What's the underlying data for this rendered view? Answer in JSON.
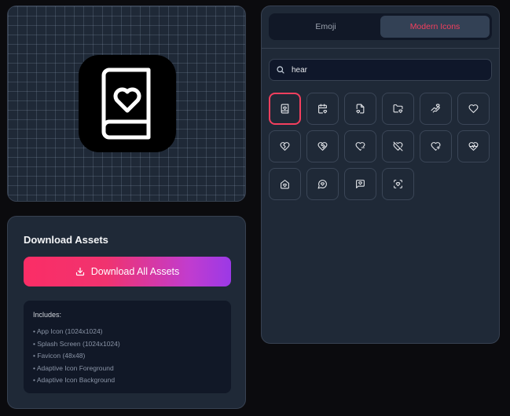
{
  "download": {
    "title": "Download Assets",
    "button_label": "Download All Assets",
    "includes_title": "Includes:",
    "includes_items": [
      "• App Icon (1024x1024)",
      "• Splash Screen (1024x1024)",
      "• Favicon (48x48)",
      "• Adaptive Icon Foreground",
      "• Adaptive Icon Background"
    ]
  },
  "tabs": {
    "emoji": "Emoji",
    "modern": "Modern Icons",
    "active": "Modern Icons"
  },
  "search": {
    "value": "hear"
  },
  "icons": [
    {
      "name": "book-heart-icon",
      "selected": true
    },
    {
      "name": "calendar-heart-icon"
    },
    {
      "name": "file-heart-icon"
    },
    {
      "name": "folder-heart-icon"
    },
    {
      "name": "hand-heart-icon"
    },
    {
      "name": "heart-icon"
    },
    {
      "name": "heart-crack-icon"
    },
    {
      "name": "heart-handshake-icon"
    },
    {
      "name": "heart-minus-icon"
    },
    {
      "name": "heart-off-icon"
    },
    {
      "name": "heart-plus-icon"
    },
    {
      "name": "heart-pulse-icon"
    },
    {
      "name": "house-heart-icon"
    },
    {
      "name": "message-circle-heart-icon"
    },
    {
      "name": "message-square-heart-icon"
    },
    {
      "name": "scan-heart-icon"
    }
  ],
  "colors": {
    "accent": "#f43f5e",
    "gradient_start": "#fb2d66",
    "gradient_end": "#9b39e6",
    "panel": "#1f2937",
    "background": "#0b0b0e"
  }
}
